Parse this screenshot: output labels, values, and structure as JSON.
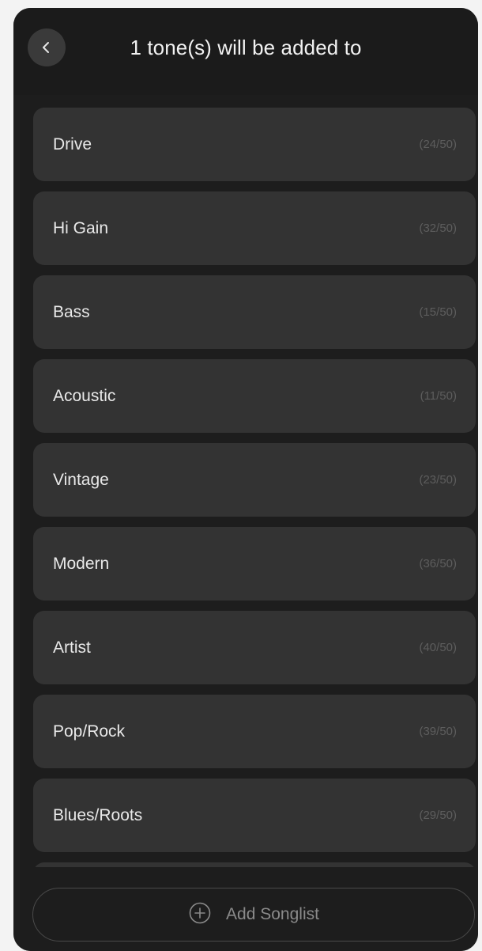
{
  "header": {
    "title": "1 tone(s) will be added to",
    "back_icon": "chevron-left-icon"
  },
  "songlists": [
    {
      "name": "Drive",
      "count": "(24/50)"
    },
    {
      "name": "Hi Gain",
      "count": "(32/50)"
    },
    {
      "name": "Bass",
      "count": "(15/50)"
    },
    {
      "name": "Acoustic",
      "count": "(11/50)"
    },
    {
      "name": "Vintage",
      "count": "(23/50)"
    },
    {
      "name": "Modern",
      "count": "(36/50)"
    },
    {
      "name": "Artist",
      "count": "(40/50)"
    },
    {
      "name": "Pop/Rock",
      "count": "(39/50)"
    },
    {
      "name": "Blues/Roots",
      "count": "(29/50)"
    },
    {
      "name": "",
      "count": ""
    }
  ],
  "footer": {
    "add_label": "Add Songlist",
    "add_icon": "plus-circle-icon"
  },
  "colors": {
    "background": "#1d1d1d",
    "item_background": "#333333",
    "text": "#e9e9e9",
    "count_text": "#5d5d5d"
  }
}
